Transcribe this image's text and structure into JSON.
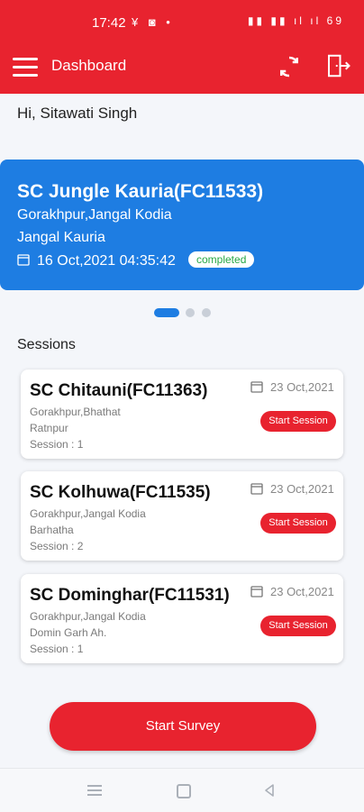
{
  "status_bar": {
    "time": "17:42",
    "left_icons": "¥ ◙ •",
    "right_icons": "▮▮ ▮▮ ıl ıl 69"
  },
  "header": {
    "title": "Dashboard",
    "menu_icon": "menu-icon",
    "sync_icon": "sync-icon",
    "logout_icon": "logout-icon"
  },
  "greeting": "Hi, Sitawati Singh",
  "hero": {
    "title": "SC Jungle Kauria(FC11533)",
    "location_line1": "Gorakhpur,Jangal Kodia",
    "location_line2": "Jangal Kauria",
    "datetime": "16 Oct,2021 04:35:42",
    "status": "completed",
    "color": "#1e7de2"
  },
  "carousel": {
    "pages": 3,
    "active": 0
  },
  "sessions_label": "Sessions",
  "sessions": [
    {
      "title": "SC Chitauni(FC11363)",
      "line1": "Gorakhpur,Bhathat",
      "line2": "Ratnpur",
      "session": "Session : 1",
      "date": "23 Oct,2021",
      "button": "Start Session"
    },
    {
      "title": "SC Kolhuwa(FC11535)",
      "line1": "Gorakhpur,Jangal Kodia",
      "line2": "Barhatha",
      "session": "Session : 2",
      "date": "23 Oct,2021",
      "button": "Start Session"
    },
    {
      "title": "SC Dominghar(FC11531)",
      "line1": "Gorakhpur,Jangal Kodia",
      "line2": "Domin Garh Ah.",
      "session": "Session : 1",
      "date": "23 Oct,2021",
      "button": "Start Session"
    }
  ],
  "start_survey_label": "Start Survey",
  "colors": {
    "brand": "#e8232f",
    "badge_text": "#27a845"
  },
  "nav": {
    "menu": "nav-menu-icon",
    "home": "nav-home-icon",
    "back": "nav-back-icon"
  }
}
